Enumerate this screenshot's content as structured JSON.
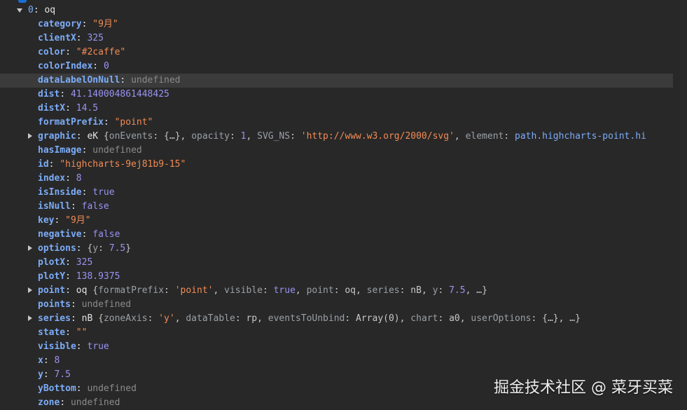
{
  "watermark": "掘金技术社区 @ 菜牙买菜",
  "root": {
    "key": "0",
    "value": "oq"
  },
  "props": {
    "category": "\"9月\"",
    "clientX": "325",
    "color": "\"#2caffe\"",
    "colorIndex": "0",
    "dataLabelOnNull": "undefined",
    "dist": "41.140004861448425",
    "distX": "14.5",
    "formatPrefix": "\"point\"",
    "graphic_class": "eK",
    "graphic_preview": {
      "k1": "onEvents",
      "v1": "{…}",
      "k2": "opacity",
      "v2": "1",
      "k3": "SVG_NS",
      "v3": "'http://www.w3.org/2000/svg'",
      "k4": "element",
      "v4": "path.highcharts-point.hi"
    },
    "hasImage": "undefined",
    "id": "\"highcharts-9ej81b9-15\"",
    "index": "8",
    "isInside": "true",
    "isNull": "false",
    "key": "\"9月\"",
    "negative": "false",
    "options_preview": {
      "k1": "y",
      "v1": "7.5"
    },
    "plotX": "325",
    "plotY": "138.9375",
    "point_class": "oq",
    "point_preview": {
      "k1": "formatPrefix",
      "v1": "'point'",
      "k2": "visible",
      "v2": "true",
      "k3": "point",
      "v3": "oq",
      "k4": "series",
      "v4": "nB",
      "k5": "y",
      "v5": "7.5",
      "more": "…"
    },
    "points": "undefined",
    "series_class": "nB",
    "series_preview": {
      "k1": "zoneAxis",
      "v1": "'y'",
      "k2": "dataTable",
      "v2": "rp",
      "k3": "eventsToUnbind",
      "v3": "Array(0)",
      "k4": "chart",
      "v4": "a0",
      "k5": "userOptions",
      "v5": "{…}",
      "more": "…"
    },
    "state": "\"\"",
    "visible": "true",
    "x": "8",
    "y": "7.5",
    "yBottom": "undefined",
    "zone": "undefined"
  },
  "labels": {
    "category": "category",
    "clientX": "clientX",
    "color": "color",
    "colorIndex": "colorIndex",
    "dataLabelOnNull": "dataLabelOnNull",
    "dist": "dist",
    "distX": "distX",
    "formatPrefix": "formatPrefix",
    "graphic": "graphic",
    "hasImage": "hasImage",
    "id": "id",
    "index": "index",
    "isInside": "isInside",
    "isNull": "isNull",
    "key": "key",
    "negative": "negative",
    "options": "options",
    "plotX": "plotX",
    "plotY": "plotY",
    "point": "point",
    "points": "points",
    "series": "series",
    "state": "state",
    "visible": "visible",
    "x": "x",
    "y": "y",
    "yBottom": "yBottom",
    "zone": "zone"
  },
  "colors": {
    "background": "#282828",
    "key": "#7cacf8",
    "string": "#f28b54",
    "number": "#9a93f3",
    "undefined": "#8b8b8b",
    "highlight": "#3b3b3b"
  }
}
